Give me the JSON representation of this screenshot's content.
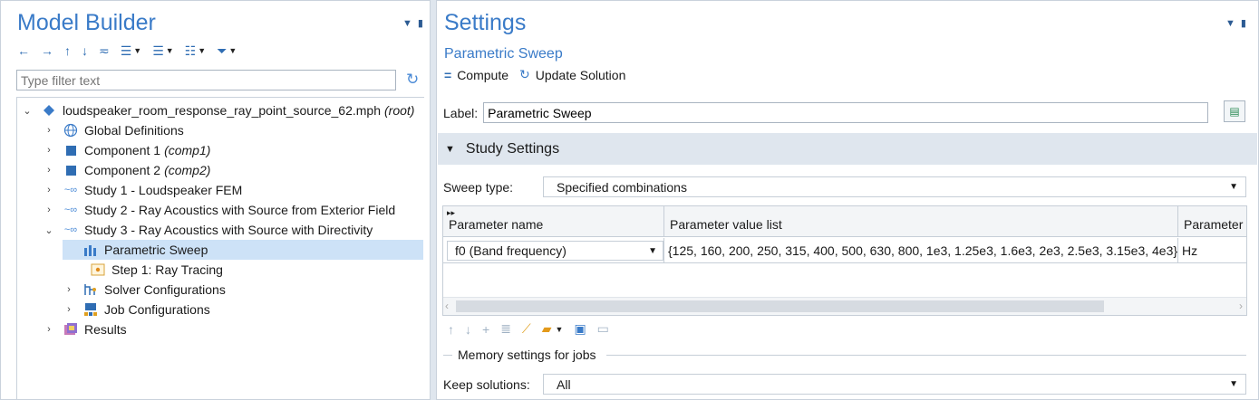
{
  "model_builder": {
    "title": "Model Builder",
    "filter_placeholder": "Type filter text",
    "tree": [
      {
        "toggle": "⌄",
        "label": "loudspeaker_room_response_ray_point_source_62.mph",
        "suffix": "(root)",
        "icon": "root-model-icon"
      },
      {
        "toggle": "›",
        "label": "Global Definitions",
        "suffix": "",
        "icon": "globe-icon"
      },
      {
        "toggle": "›",
        "label": "Component 1",
        "suffix": "(comp1)",
        "icon": "component-cube-icon"
      },
      {
        "toggle": "›",
        "label": "Component 2",
        "suffix": "(comp2)",
        "icon": "component-cube-icon"
      },
      {
        "toggle": "›",
        "label": "Study 1 - Loudspeaker FEM",
        "suffix": "",
        "icon": "study-icon"
      },
      {
        "toggle": "›",
        "label": "Study 2 - Ray Acoustics with Source from Exterior Field",
        "suffix": "",
        "icon": "study-icon"
      },
      {
        "toggle": "⌄",
        "label": "Study 3 - Ray Acoustics with Source with Directivity",
        "suffix": "",
        "icon": "study-icon"
      },
      {
        "toggle": "",
        "label": "Parametric Sweep",
        "suffix": "",
        "icon": "parametric-sweep-icon"
      },
      {
        "toggle": "",
        "label": "Step 1: Ray Tracing",
        "suffix": "",
        "icon": "ray-tracing-step-icon"
      },
      {
        "toggle": "›",
        "label": "Solver Configurations",
        "suffix": "",
        "icon": "solver-configurations-icon"
      },
      {
        "toggle": "›",
        "label": "Job Configurations",
        "suffix": "",
        "icon": "job-configurations-icon"
      },
      {
        "toggle": "›",
        "label": "Results",
        "suffix": "",
        "icon": "results-icon"
      }
    ]
  },
  "settings": {
    "title": "Settings",
    "subtitle": "Parametric Sweep",
    "compute_label": "Compute",
    "update_label": "Update Solution",
    "label_caption": "Label:",
    "label_value": "Parametric Sweep",
    "section_title": "Study Settings",
    "sweep_type_caption": "Sweep type:",
    "sweep_type_value": "Specified combinations",
    "table": {
      "headers": [
        "Parameter name",
        "Parameter value list",
        "Parameter"
      ],
      "rows": [
        [
          "f0 (Band frequency)",
          "{125, 160, 200, 250, 315, 400, 500, 630, 800, 1e3, 1.25e3, 1.6e3, 2e3, 2.5e3, 3.15e3, 4e3}",
          "Hz"
        ]
      ]
    },
    "memory_group": "Memory settings for jobs",
    "keep_caption": "Keep solutions:",
    "keep_value": "All"
  },
  "colors": {
    "accent": "#3a7bc8",
    "selection": "#cde2f7",
    "section_bg": "#dfe6ee"
  }
}
